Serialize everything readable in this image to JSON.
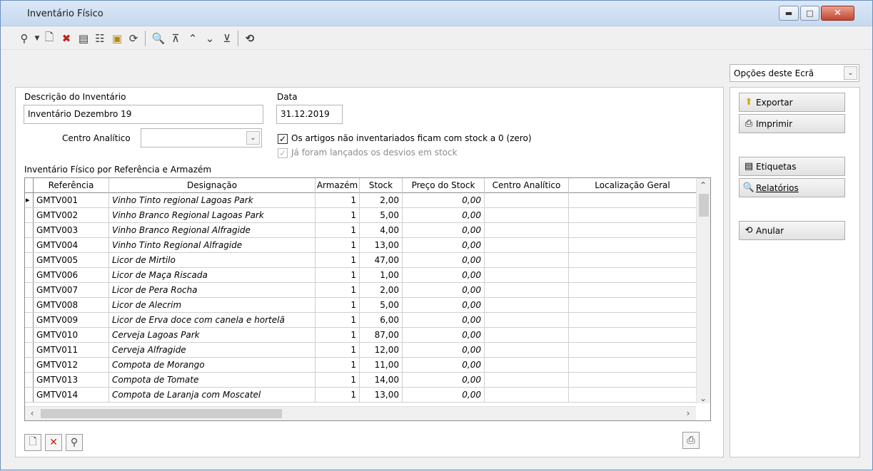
{
  "window": {
    "title": "Inventário Físico"
  },
  "toolbar": {
    "icons": [
      "search-icon",
      "dropdown-arrow-icon",
      "new-document-icon",
      "delete-icon",
      "properties-icon",
      "hierarchy-icon",
      "search-folder-icon",
      "refresh-icon",
      "preview-icon",
      "first-record-icon",
      "previous-record-icon",
      "next-record-icon",
      "last-record-icon",
      "undo-icon"
    ]
  },
  "form": {
    "description_label": "Descrição do Inventário",
    "description_value": "Inventário Dezembro 19",
    "date_label": "Data",
    "date_value": "31.12.2019",
    "centro_label": "Centro Analítico",
    "centro_value": "",
    "check_zero_label": "Os artigos não inventariados ficam com stock a 0 (zero)",
    "check_zero_checked": true,
    "check_desvios_label": "Já foram lançados os desvios em stock",
    "check_desvios_checked": true,
    "grid_title": "Inventário Físico por Referência e Armazém"
  },
  "grid": {
    "columns": [
      "Referência",
      "Designação",
      "Armazém",
      "Stock",
      "Preço do Stock",
      "Centro Analítico",
      "Localização Geral"
    ],
    "rows": [
      {
        "ref": "GMTV001",
        "des": "Vinho Tinto regional Lagoas Park",
        "arm": "1",
        "stock": "2,00",
        "preco": "0,00"
      },
      {
        "ref": "GMTV002",
        "des": "Vinho Branco Regional Lagoas Park",
        "arm": "1",
        "stock": "5,00",
        "preco": "0,00"
      },
      {
        "ref": "GMTV003",
        "des": "Vinho Branco Regional Alfragide",
        "arm": "1",
        "stock": "4,00",
        "preco": "0,00"
      },
      {
        "ref": "GMTV004",
        "des": "Vinho Tinto Regional Alfragide",
        "arm": "1",
        "stock": "13,00",
        "preco": "0,00"
      },
      {
        "ref": "GMTV005",
        "des": "Licor de Mirtilo",
        "arm": "1",
        "stock": "47,00",
        "preco": "0,00"
      },
      {
        "ref": "GMTV006",
        "des": "Licor de Maça Riscada",
        "arm": "1",
        "stock": "1,00",
        "preco": "0,00"
      },
      {
        "ref": "GMTV007",
        "des": "Licor de Pera Rocha",
        "arm": "1",
        "stock": "2,00",
        "preco": "0,00"
      },
      {
        "ref": "GMTV008",
        "des": "Licor de Alecrim",
        "arm": "1",
        "stock": "5,00",
        "preco": "0,00"
      },
      {
        "ref": "GMTV009",
        "des": "Licor de Erva doce com canela e hortelã",
        "arm": "1",
        "stock": "6,00",
        "preco": "0,00"
      },
      {
        "ref": "GMTV010",
        "des": "Cerveja Lagoas Park",
        "arm": "1",
        "stock": "87,00",
        "preco": "0,00"
      },
      {
        "ref": "GMTV011",
        "des": "Cerveja Alfragide",
        "arm": "1",
        "stock": "12,00",
        "preco": "0,00"
      },
      {
        "ref": "GMTV012",
        "des": "Compota de Morango",
        "arm": "1",
        "stock": "11,00",
        "preco": "0,00"
      },
      {
        "ref": "GMTV013",
        "des": "Compota de Tomate",
        "arm": "1",
        "stock": "14,00",
        "preco": "0,00"
      },
      {
        "ref": "GMTV014",
        "des": "Compota de Laranja com Moscatel",
        "arm": "1",
        "stock": "13,00",
        "preco": "0,00"
      }
    ]
  },
  "side": {
    "options_label": "Opções deste Ecrã",
    "exportar": "Exportar",
    "imprimir": "Imprimir",
    "etiquetas": "Etiquetas",
    "relatorios": "Relatórios",
    "anular": "Anular"
  }
}
